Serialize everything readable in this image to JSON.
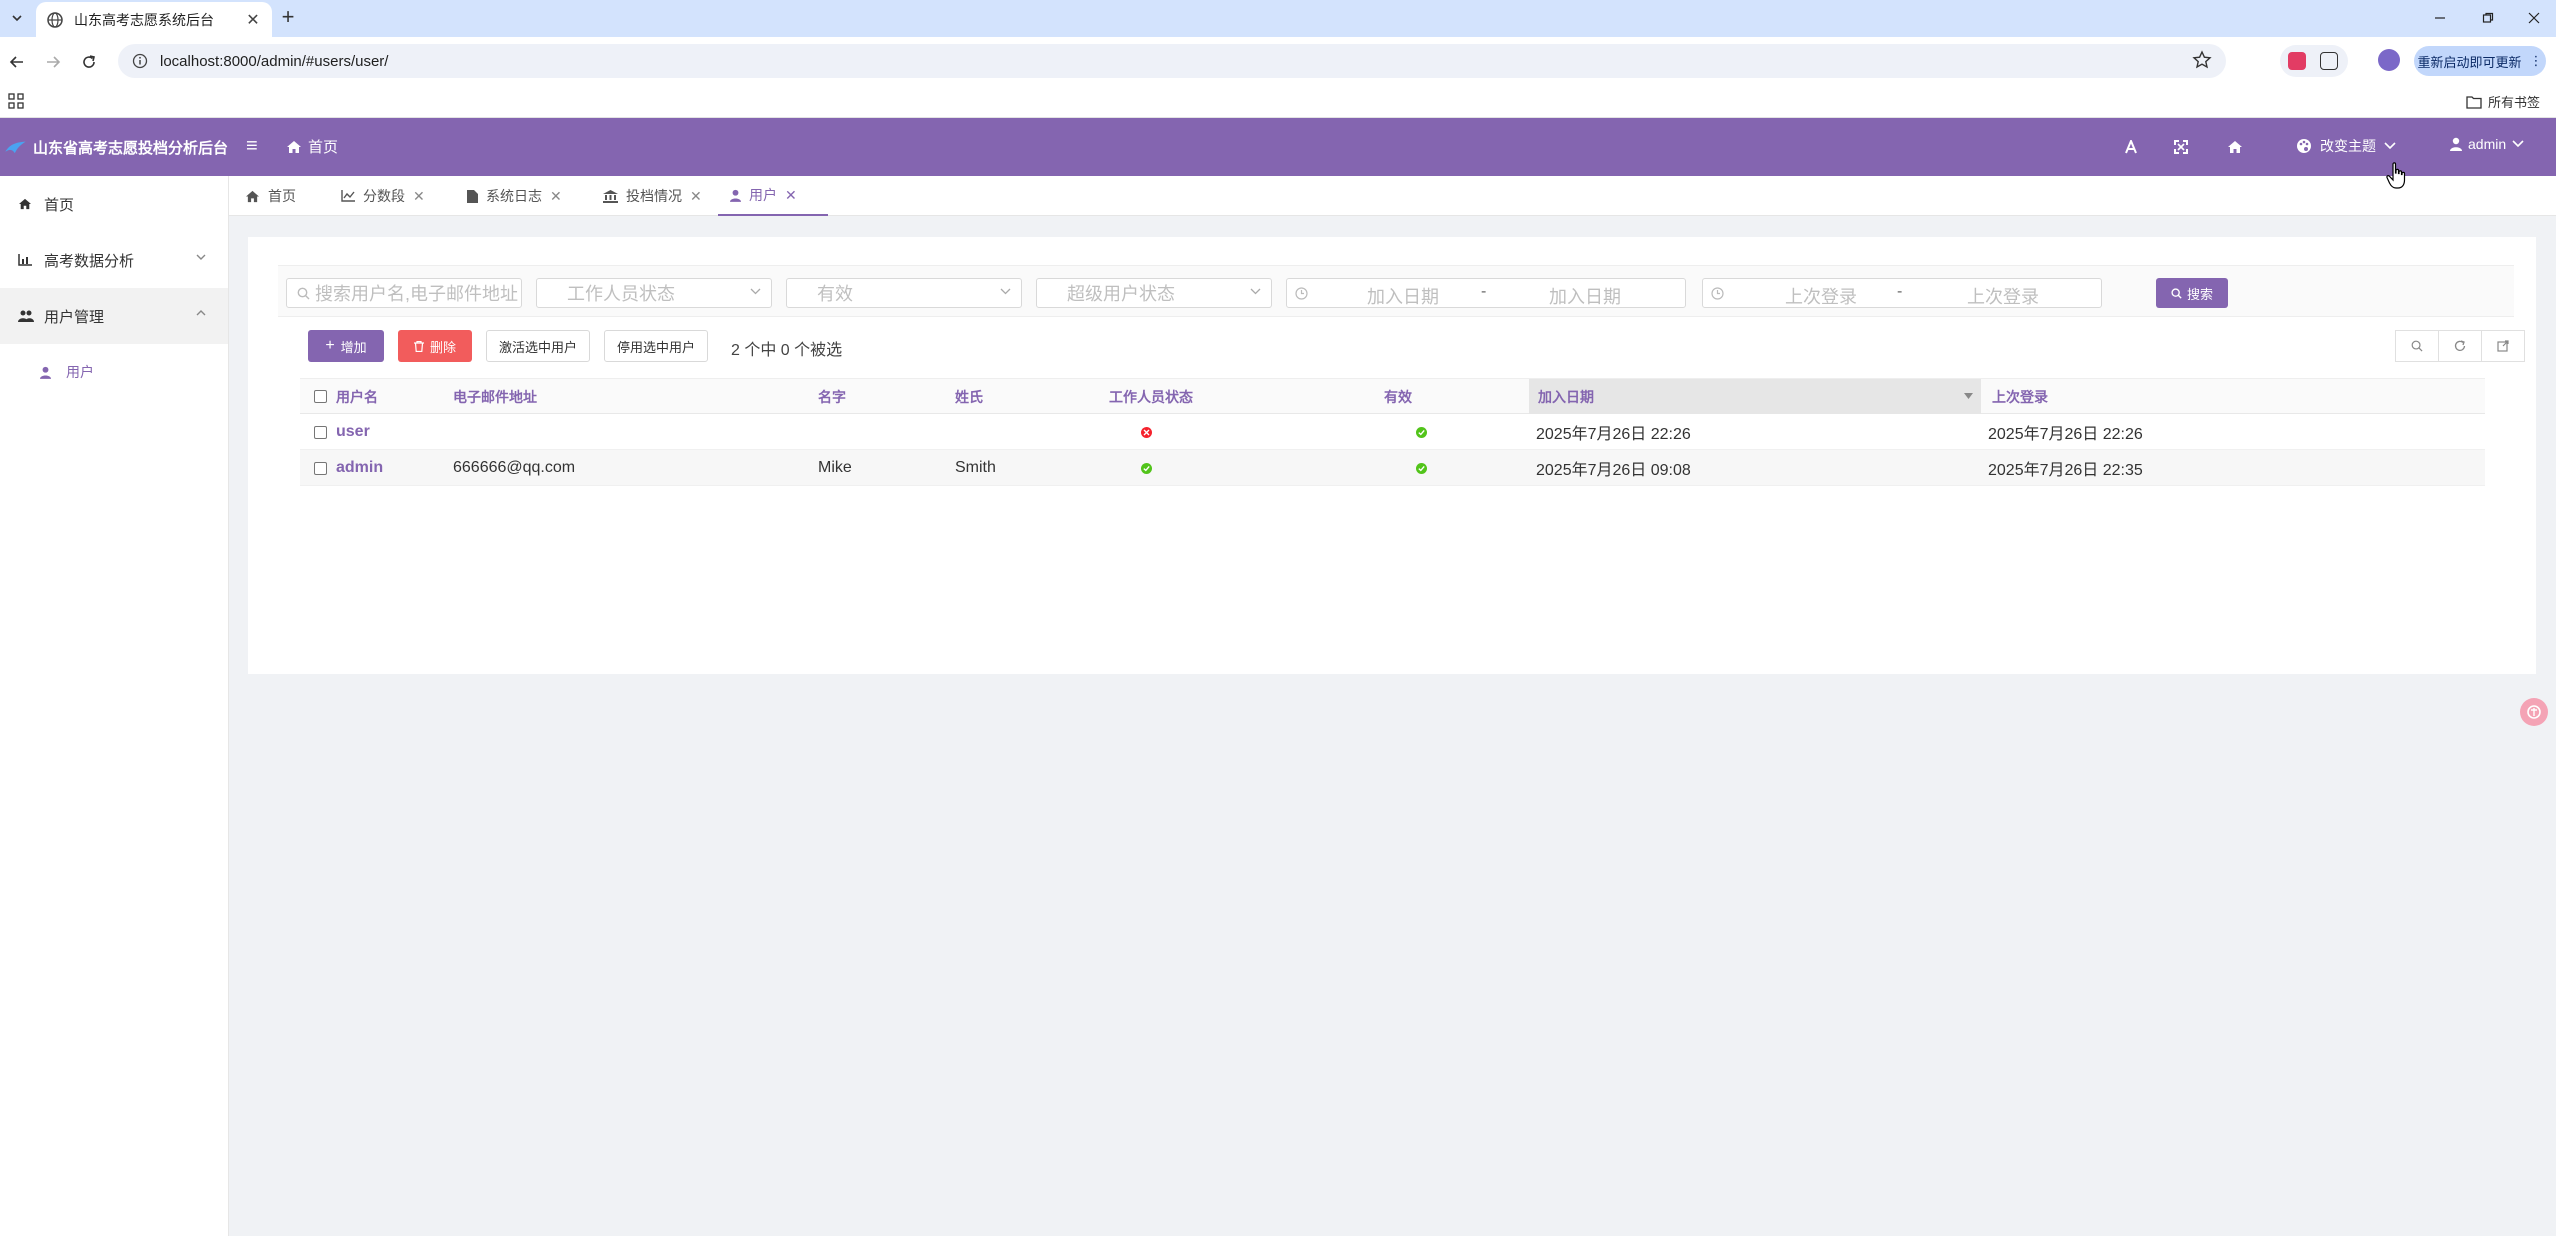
{
  "browser": {
    "tab_title": "山东高考志愿系统后台",
    "url": "localhost:8000/admin/#users/user/",
    "update_label": "重新启动即可更新",
    "bookmarks_label": "所有书签"
  },
  "header": {
    "brand_title": "山东省高考志愿投档分析后台",
    "home_label": "首页",
    "theme_label": "改变主题",
    "user_label": "admin"
  },
  "sidebar": {
    "items": [
      {
        "label": "首页",
        "icon": "home-icon"
      },
      {
        "label": "高考数据分析",
        "icon": "chart-icon"
      },
      {
        "label": "用户管理",
        "icon": "users-icon"
      }
    ],
    "sub_items": [
      {
        "label": "用户",
        "icon": "user-icon"
      }
    ]
  },
  "page_tabs": [
    {
      "label": "首页",
      "icon": "home-icon"
    },
    {
      "label": "分数段",
      "icon": "line-chart-icon"
    },
    {
      "label": "系统日志",
      "icon": "file-icon"
    },
    {
      "label": "投档情况",
      "icon": "bank-icon"
    },
    {
      "label": "用户",
      "icon": "user-icon"
    }
  ],
  "filters": {
    "search_placeholder": "搜索用户名,电子邮件地址",
    "staff_status": "工作人员状态",
    "active": "有效",
    "superuser_status": "超级用户状态",
    "date_joined_start": "加入日期",
    "date_joined_end": "加入日期",
    "last_login_start": "上次登录",
    "last_login_end": "上次登录",
    "range_sep": "-",
    "search_button": "搜索"
  },
  "actions": {
    "add": "增加",
    "delete": "删除",
    "activate": "激活选中用户",
    "deactivate": "停用选中用户",
    "selection": "2 个中 0 个被选"
  },
  "table": {
    "headers": [
      "用户名",
      "电子邮件地址",
      "名字",
      "姓氏",
      "工作人员状态",
      "有效",
      "加入日期",
      "上次登录"
    ],
    "rows": [
      {
        "username": "user",
        "email": "",
        "first_name": "",
        "last_name": "",
        "is_staff": false,
        "is_active": true,
        "date_joined": "2025年7月26日 22:26",
        "last_login": "2025年7月26日 22:26"
      },
      {
        "username": "admin",
        "email": "666666@qq.com",
        "first_name": "Mike",
        "last_name": "Smith",
        "is_staff": true,
        "is_active": true,
        "date_joined": "2025年7月26日 09:08",
        "last_login": "2025年7月26日 22:35"
      }
    ]
  },
  "colors": {
    "primary": "#8465b0",
    "danger": "#f25c5c",
    "success": "#52c41a",
    "error": "#f5222d"
  }
}
